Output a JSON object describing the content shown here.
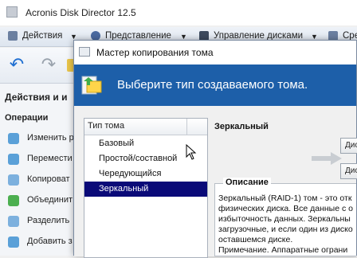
{
  "app": {
    "title": "Acronis Disk Director 12.5"
  },
  "menu": [
    {
      "label": "Действия",
      "icon": "actions-icon"
    },
    {
      "label": "Представление",
      "icon": "view-icon"
    },
    {
      "label": "Управление дисками",
      "icon": "disk-management-icon"
    },
    {
      "label": "Сре",
      "icon": "tools-icon"
    }
  ],
  "toolbar": {
    "undo_icon": "undo-icon",
    "redo_icon": "redo-icon",
    "commit_icon": "commit-icon"
  },
  "sidebar": {
    "header": "Действия и и",
    "section": "Операции",
    "items": [
      {
        "label": "Изменить р",
        "icon": "resize-icon"
      },
      {
        "label": "Перемести",
        "icon": "move-icon"
      },
      {
        "label": "Копироват",
        "icon": "copy-icon"
      },
      {
        "label": "Объединит",
        "icon": "merge-icon"
      },
      {
        "label": "Разделить",
        "icon": "split-icon"
      },
      {
        "label": "Добавить з",
        "icon": "add-icon"
      }
    ]
  },
  "dialog": {
    "title": "Мастер копирования тома",
    "banner_text": "Выберите тип создаваемого тома.",
    "list_header": "Тип тома",
    "volume_types": [
      "Базовый",
      "Простой/составной",
      "Чередующийся",
      "Зеркальный"
    ],
    "selected_index": 3,
    "selected_type_title": "Зеркальный",
    "disk_buttons": [
      "Дис",
      "Дис"
    ],
    "description_title": "Описание",
    "description_lines": [
      "Зеркальный (RAID-1) том - это отк",
      "физических диска. Все данные с о",
      "избыточность данных. Зеркальны",
      "загрузочные, и если один из диско",
      "оставшемся диске.",
      "Примечание. Аппаратные ограни"
    ]
  },
  "colors": {
    "banner": "#1d5fa9",
    "selection": "#0a0a78",
    "undo": "#1f6fd1"
  }
}
